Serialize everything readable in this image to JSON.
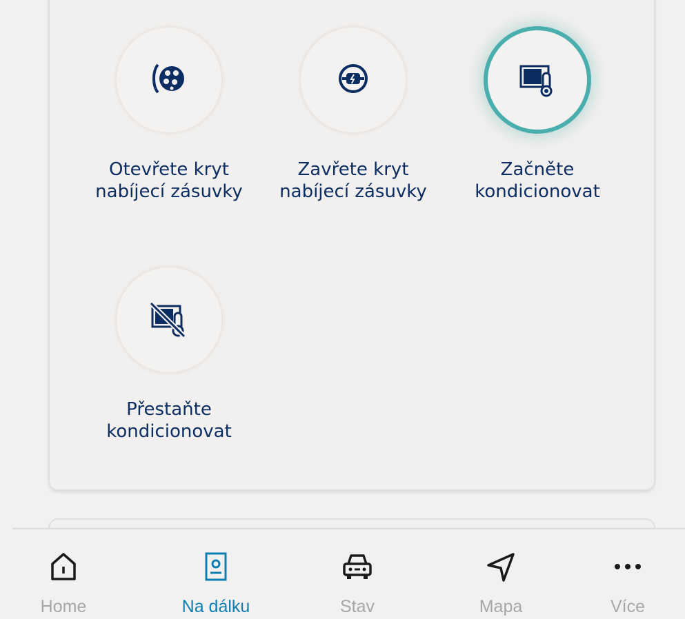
{
  "actions": [
    {
      "label": "Otevřete kryt\nnabíjecí zásuvky",
      "icon": "charge-port-open-icon",
      "active": false
    },
    {
      "label": "Zavřete kryt\nnabíjecí zásuvky",
      "icon": "charge-port-close-icon",
      "active": false
    },
    {
      "label": "Začněte\nkondicionovat",
      "icon": "climate-start-icon",
      "active": true
    },
    {
      "label": "Přestaňte\nkondicionovat",
      "icon": "climate-stop-icon",
      "active": false
    }
  ],
  "nav": {
    "items": [
      {
        "label": "Home",
        "icon": "home-icon",
        "active": false
      },
      {
        "label": "Na dálku",
        "icon": "remote-icon",
        "active": true
      },
      {
        "label": "Stav",
        "icon": "car-icon",
        "active": false
      },
      {
        "label": "Mapa",
        "icon": "navigation-arrow-icon",
        "active": false
      },
      {
        "label": "Více",
        "icon": "more-dots-icon",
        "active": false
      }
    ]
  },
  "colors": {
    "text_dark": "#0c2d62",
    "accent_teal": "#4aaeae",
    "nav_active": "#0b7fb3",
    "nav_inactive": "#a7a7a7",
    "background": "#f3f1ef"
  }
}
